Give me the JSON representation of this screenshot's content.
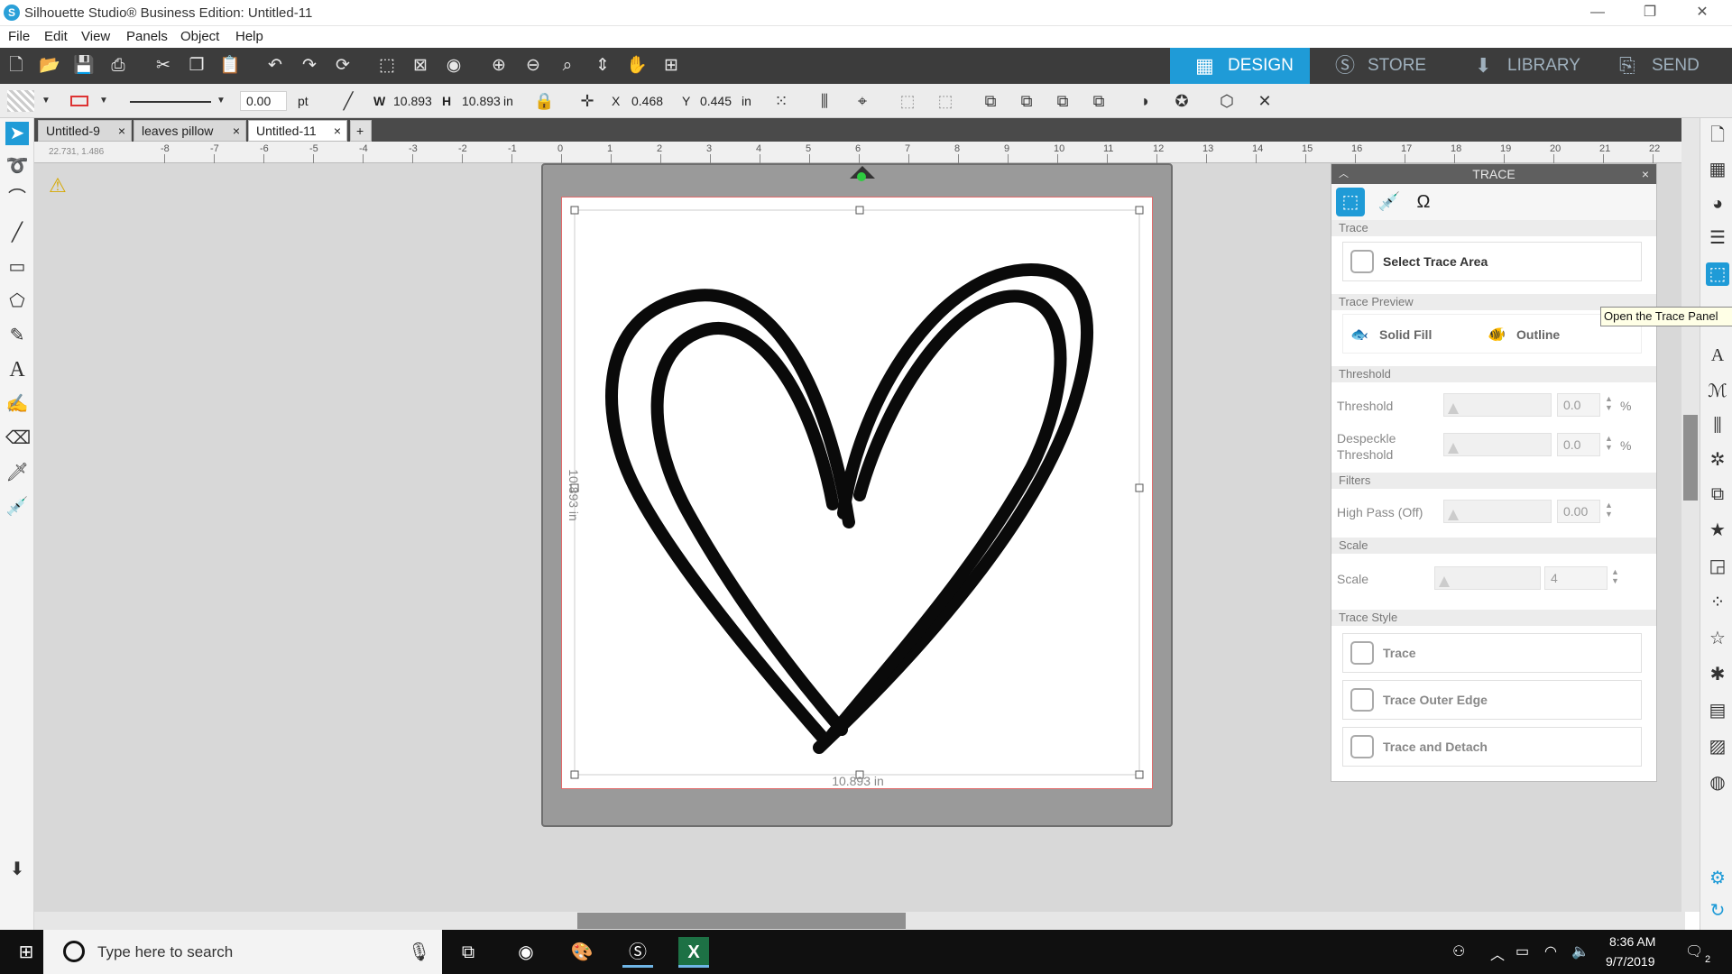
{
  "window": {
    "title": "Silhouette Studio® Business Edition: Untitled-11",
    "minimize": "—",
    "restore": "❐",
    "close": "✕"
  },
  "menu": [
    "File",
    "Edit",
    "View",
    "Panels",
    "Object",
    "Help"
  ],
  "nav_tabs": [
    {
      "label": "DESIGN",
      "icon": "grid-icon"
    },
    {
      "label": "STORE",
      "icon": "silhouette-s-icon"
    },
    {
      "label": "LIBRARY",
      "icon": "library-download-icon"
    },
    {
      "label": "SEND",
      "icon": "cutter-icon"
    }
  ],
  "properties": {
    "line_width": "0.00",
    "line_unit": "pt",
    "w_label": "W",
    "w_value": "10.893",
    "h_label": "H",
    "h_value": "10.893",
    "size_unit": "in",
    "x_label": "X",
    "x_value": "0.468",
    "y_label": "Y",
    "y_value": "0.445",
    "pos_unit": "in"
  },
  "doc_tabs": [
    {
      "label": "Untitled-9",
      "close": "×"
    },
    {
      "label": "leaves pillow",
      "close": "×"
    },
    {
      "label": "Untitled-11",
      "close": "×",
      "active": true
    }
  ],
  "add_tab": "+",
  "ruler": {
    "coords": "22.731, 1.486",
    "ticks": [
      "-8",
      "-7",
      "-6",
      "-5",
      "-4",
      "-3",
      "-2",
      "-1",
      "0",
      "1",
      "2",
      "3",
      "4",
      "5",
      "6",
      "7",
      "8",
      "9",
      "10",
      "11",
      "12",
      "13",
      "14",
      "15",
      "16",
      "17",
      "18",
      "19",
      "20",
      "21",
      "22"
    ]
  },
  "canvas": {
    "width_label": "10.893 in",
    "height_label": "10.893 in"
  },
  "trace_panel": {
    "title": "TRACE",
    "close": "×",
    "trace_section": "Trace",
    "select_area": "Select Trace Area",
    "preview_section": "Trace Preview",
    "solid_fill": "Solid Fill",
    "outline": "Outline",
    "threshold_section": "Threshold",
    "threshold_label": "Threshold",
    "threshold_value": "0.0",
    "despeckle_label_1": "Despeckle",
    "despeckle_label_2": "Threshold",
    "despeckle_value": "0.0",
    "percent": "%",
    "filters_section": "Filters",
    "high_pass_label": "High Pass (Off)",
    "high_pass_value": "0.00",
    "scale_section": "Scale",
    "scale_label": "Scale",
    "scale_value": "4",
    "style_section": "Trace Style",
    "style_trace": "Trace",
    "style_outer": "Trace Outer Edge",
    "style_detach": "Trace and Detach"
  },
  "tooltip": "Open the Trace Panel",
  "taskbar": {
    "search_placeholder": "Type here to search",
    "time": "8:36 AM",
    "date": "9/7/2019",
    "notifications": "2"
  },
  "colors": {
    "accent": "#1f9bd7",
    "toolbar": "#3c3c3c",
    "mat": "#9a9a9a",
    "cut_line": "#e26a6a"
  }
}
